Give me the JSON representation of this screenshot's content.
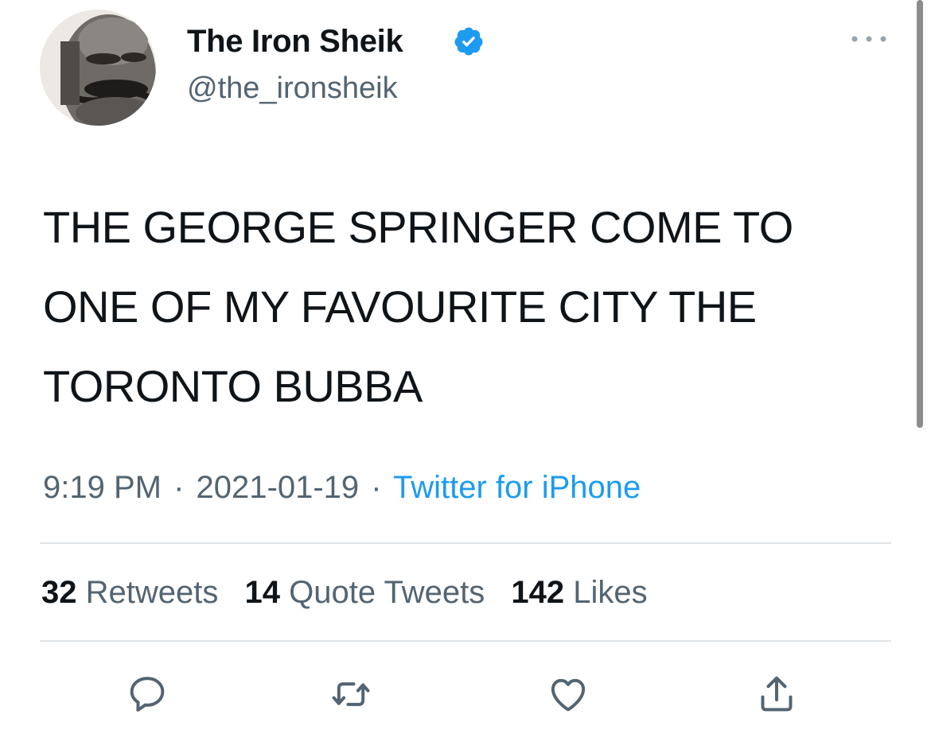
{
  "tweet": {
    "author": {
      "display_name": "The Iron Sheik",
      "handle": "@the_ironsheik",
      "verified": true
    },
    "text_lines": [
      "THE GEORGE SPRINGER COME TO",
      "ONE OF MY FAVOURITE CITY THE",
      "TORONTO BUBBA"
    ],
    "meta": {
      "time": "9:19 PM",
      "separator": "·",
      "date": "2021-01-19",
      "source": "Twitter for iPhone"
    },
    "stats": {
      "retweets": {
        "count": "32",
        "label": "Retweets"
      },
      "quote_tweets": {
        "count": "14",
        "label": "Quote Tweets"
      },
      "likes": {
        "count": "142",
        "label": "Likes"
      }
    },
    "actions": [
      "reply-icon",
      "retweet-icon",
      "like-icon",
      "share-icon"
    ]
  },
  "colors": {
    "text_primary": "#0f1419",
    "text_secondary": "#536471",
    "accent": "#1d9bf0",
    "divider": "#dfe3e6"
  }
}
